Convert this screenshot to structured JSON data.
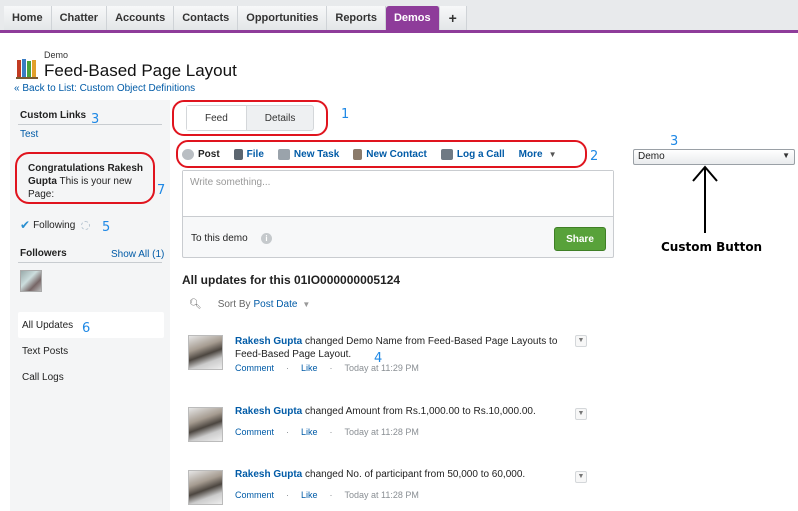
{
  "tabs": [
    "Home",
    "Chatter",
    "Accounts",
    "Contacts",
    "Opportunities",
    "Reports",
    "Demos",
    "+"
  ],
  "header": {
    "object_label": "Demo",
    "title": "Feed-Based Page Layout",
    "back_link": "« Back to List: Custom Object Definitions"
  },
  "sidebar": {
    "custom_links_heading": "Custom Links",
    "custom_link": "Test",
    "congrats_bold": "Congratulations Rakesh Gupta",
    "congrats_rest": " This is your new Page:",
    "following": "Following",
    "followers_heading": "Followers",
    "show_all": "Show All (1)",
    "nav": [
      "All Updates",
      "Text Posts",
      "Call Logs"
    ]
  },
  "view_tabs": [
    "Feed",
    "Details"
  ],
  "publisher": {
    "actions": [
      "Post",
      "File",
      "New Task",
      "New Contact",
      "Log a Call",
      "More"
    ],
    "placeholder": "Write something...",
    "to_label": "To this demo",
    "share": "Share"
  },
  "updates": {
    "title": "All updates for this 01IO000000005124",
    "sort_label": "Sort By",
    "sort_value": "Post Date",
    "posts": [
      {
        "who": "Rakesh Gupta",
        "text": " changed Demo Name from Feed-Based Page Layouts to Feed-Based Page Layout.",
        "comment": "Comment",
        "like": "Like",
        "time": "Today at 11:29 PM"
      },
      {
        "who": "Rakesh Gupta",
        "text": " changed Amount from Rs.1,000.00 to Rs.10,000.00.",
        "comment": "Comment",
        "like": "Like",
        "time": "Today at 11:28 PM"
      },
      {
        "who": "Rakesh Gupta",
        "text": " changed No. of participant from 50,000 to 60,000.",
        "comment": "Comment",
        "like": "Like",
        "time": "Today at 11:28 PM"
      }
    ]
  },
  "right_select": {
    "value": "Demo"
  },
  "annotations": {
    "labels": [
      "1",
      "2",
      "3",
      "3",
      "4",
      "5",
      "6",
      "7"
    ],
    "custom_button": "Custom Button",
    "color": "#e0141e",
    "number_color": "#1e88e5"
  },
  "colors": {
    "accent": "#8e3c9a",
    "link": "#015ba7",
    "share": "#58a23a"
  }
}
